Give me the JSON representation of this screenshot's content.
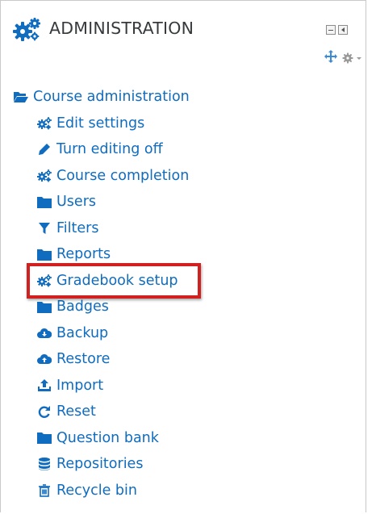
{
  "block": {
    "title": "ADMINISTRATION",
    "header_icon": "gears-icon",
    "controls": {
      "minimize": "minimize-icon",
      "dock": "dock-icon",
      "move": "move-icon",
      "actions": "cog-menu-icon"
    }
  },
  "tree": {
    "root": {
      "label": "Course administration",
      "icon": "folder-open-icon"
    },
    "items": [
      {
        "label": "Edit settings",
        "icon": "gears-icon"
      },
      {
        "label": "Turn editing off",
        "icon": "pencil-icon"
      },
      {
        "label": "Course completion",
        "icon": "gears-icon"
      },
      {
        "label": "Users",
        "icon": "folder-icon"
      },
      {
        "label": "Filters",
        "icon": "filter-icon"
      },
      {
        "label": "Reports",
        "icon": "folder-icon"
      },
      {
        "label": "Gradebook setup",
        "icon": "gears-icon",
        "highlighted": true
      },
      {
        "label": "Badges",
        "icon": "folder-icon"
      },
      {
        "label": "Backup",
        "icon": "cloud-download-icon"
      },
      {
        "label": "Restore",
        "icon": "cloud-upload-icon"
      },
      {
        "label": "Import",
        "icon": "upload-icon"
      },
      {
        "label": "Reset",
        "icon": "refresh-icon"
      },
      {
        "label": "Question bank",
        "icon": "folder-icon"
      },
      {
        "label": "Repositories",
        "icon": "database-icon"
      },
      {
        "label": "Recycle bin",
        "icon": "trash-icon"
      }
    ]
  },
  "colors": {
    "link": "#0f6cbf",
    "title": "#373a3c",
    "highlight_border": "#d02020",
    "border": "#c9c9c9"
  }
}
